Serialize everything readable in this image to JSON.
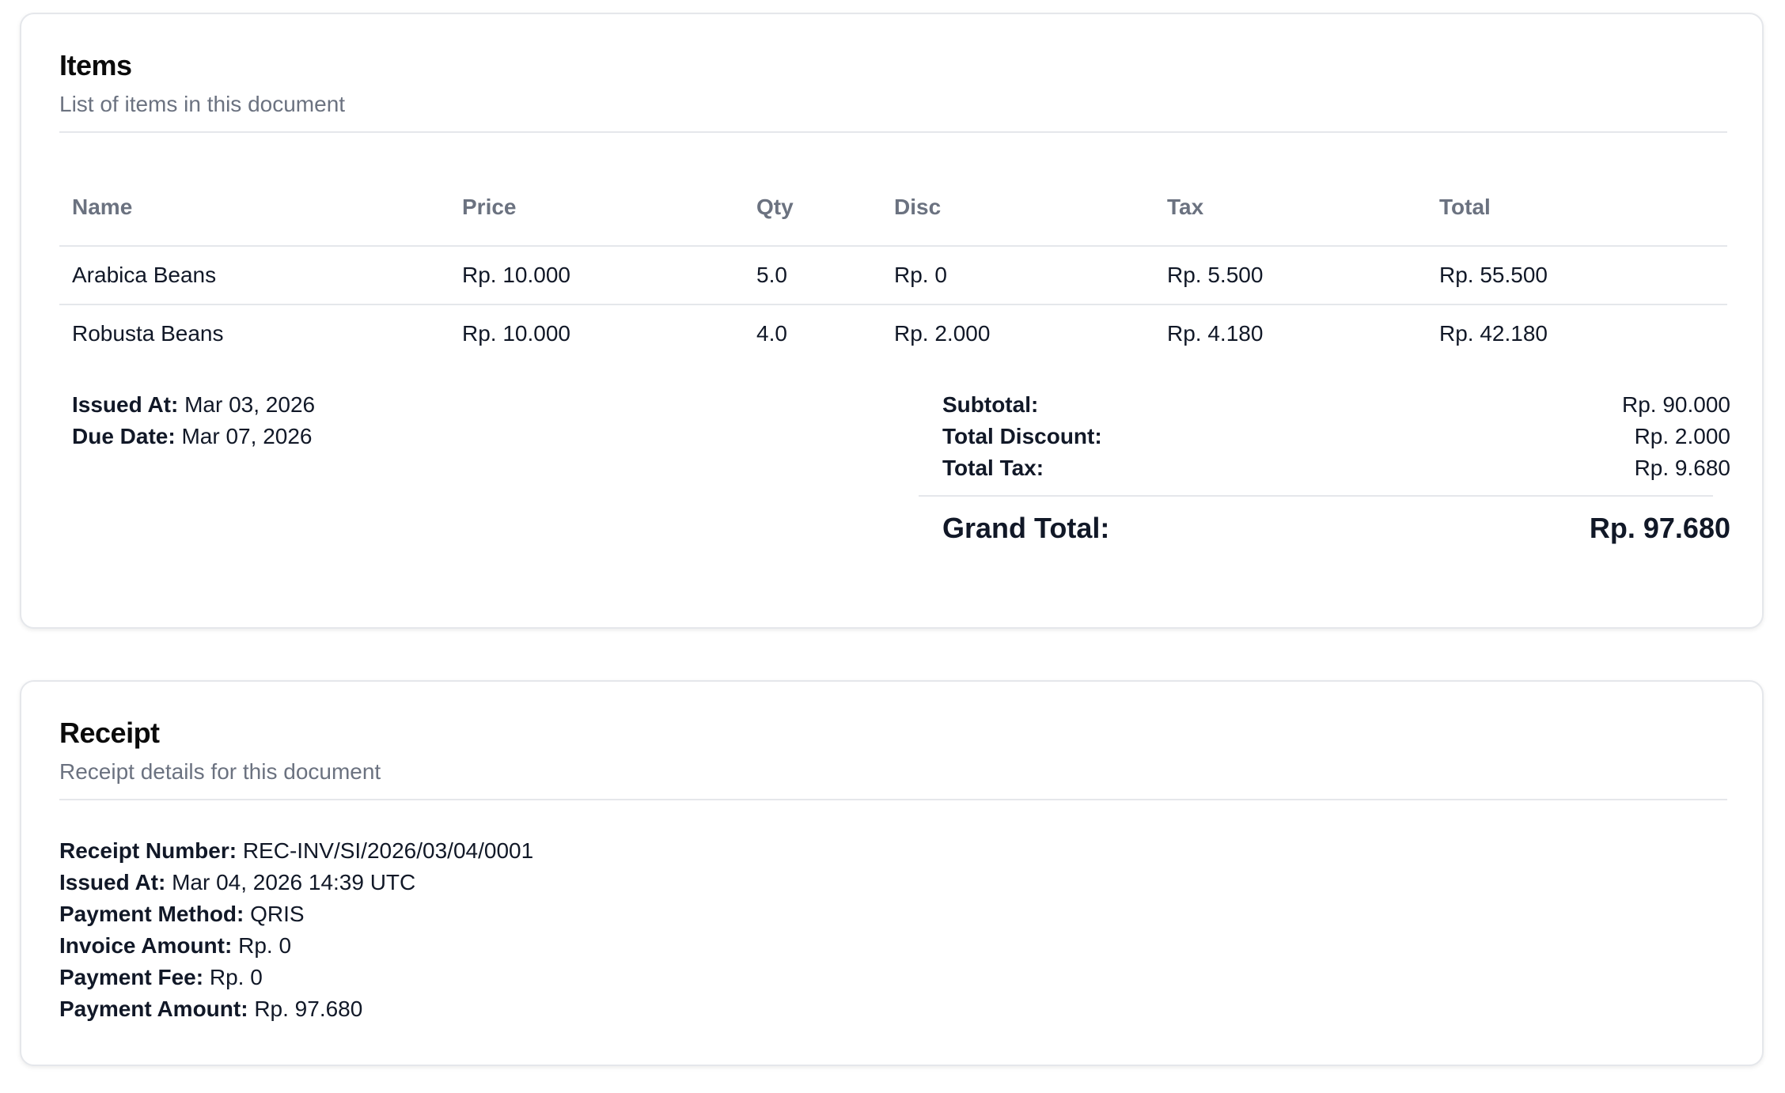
{
  "items_card": {
    "title": "Items",
    "subtitle": "List of items in this document",
    "columns": [
      "Name",
      "Price",
      "Qty",
      "Disc",
      "Tax",
      "Total"
    ],
    "rows": [
      [
        "Arabica Beans",
        "Rp. 10.000",
        "5.0",
        "Rp. 0",
        "Rp. 5.500",
        "Rp. 55.500"
      ],
      [
        "Robusta Beans",
        "Rp. 10.000",
        "4.0",
        "Rp. 2.000",
        "Rp. 4.180",
        "Rp. 42.180"
      ]
    ],
    "issued_at": {
      "label": "Issued At:",
      "value": "Mar 03, 2026"
    },
    "due_date": {
      "label": "Due Date:",
      "value": "Mar 07, 2026"
    },
    "totals": {
      "subtotal": {
        "label": "Subtotal:",
        "value": "Rp. 90.000"
      },
      "total_discount": {
        "label": "Total Discount:",
        "value": "Rp. 2.000"
      },
      "total_tax": {
        "label": "Total Tax:",
        "value": "Rp. 9.680"
      },
      "grand_total": {
        "label": "Grand Total:",
        "value": "Rp. 97.680"
      }
    }
  },
  "receipt_card": {
    "title": "Receipt",
    "subtitle": "Receipt details for this document",
    "fields": [
      {
        "label": "Receipt Number:",
        "value": "REC-INV/SI/2026/03/04/0001"
      },
      {
        "label": "Issued At:",
        "value": "Mar 04, 2026 14:39 UTC"
      },
      {
        "label": "Payment Method:",
        "value": "QRIS"
      },
      {
        "label": "Invoice Amount:",
        "value": "Rp. 0"
      },
      {
        "label": "Payment Fee:",
        "value": "Rp. 0"
      },
      {
        "label": "Payment Amount:",
        "value": "Rp. 97.680"
      }
    ]
  }
}
